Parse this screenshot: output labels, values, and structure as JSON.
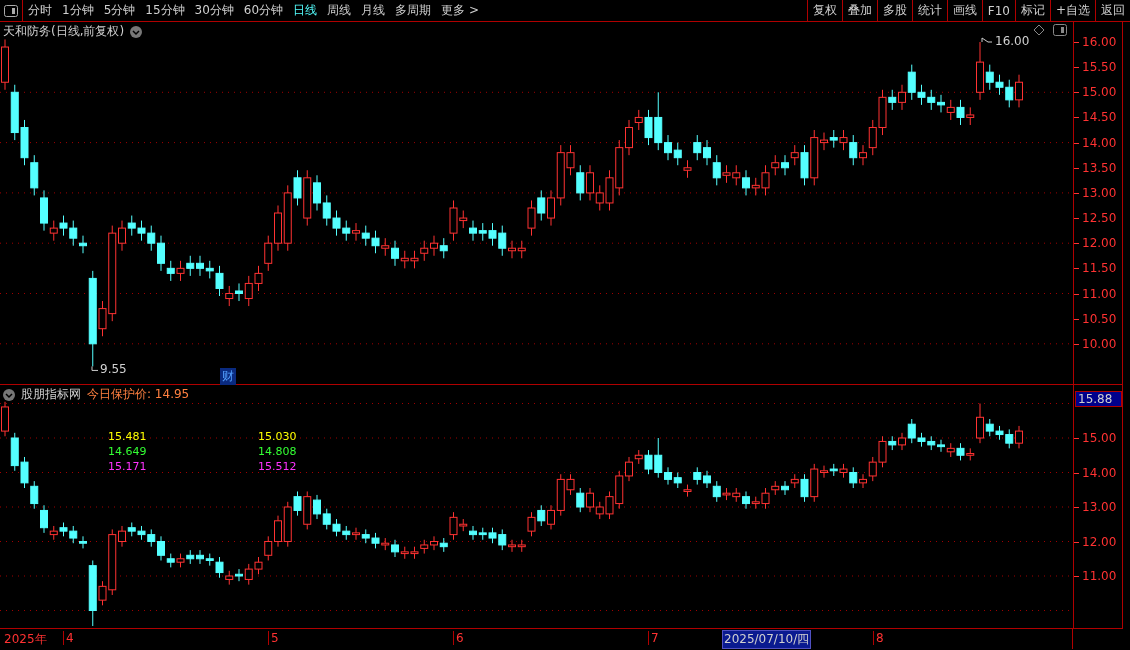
{
  "toolbar": {
    "periods": [
      {
        "label": "分时",
        "selected": false
      },
      {
        "label": "1分钟",
        "selected": false
      },
      {
        "label": "5分钟",
        "selected": false
      },
      {
        "label": "15分钟",
        "selected": false
      },
      {
        "label": "30分钟",
        "selected": false
      },
      {
        "label": "60分钟",
        "selected": false
      },
      {
        "label": "日线",
        "selected": true
      },
      {
        "label": "周线",
        "selected": false
      },
      {
        "label": "月线",
        "selected": false
      },
      {
        "label": "多周期",
        "selected": false
      },
      {
        "label": "更多 >",
        "selected": false
      }
    ],
    "actions": [
      "复权",
      "叠加",
      "多股",
      "统计",
      "画线",
      "F10",
      "标记",
      "+自选",
      "返回"
    ]
  },
  "main_chart": {
    "title": "天和防务(日线,前复权)",
    "high_label": "16.00",
    "low_label": "9.55",
    "badge": "财",
    "y_ticks": [
      "16.00",
      "15.50",
      "15.00",
      "14.50",
      "14.00",
      "13.50",
      "13.00",
      "12.50",
      "12.00",
      "11.50",
      "11.00",
      "10.50",
      "10.00"
    ]
  },
  "indicator": {
    "name": "股朋指标网",
    "protect_price": "今日保护价: 14.95",
    "values": [
      {
        "text": "15.481",
        "color": "#ffff00"
      },
      {
        "text": "15.030",
        "color": "#ffff00"
      },
      {
        "text": "14.649",
        "color": "#33ff33"
      },
      {
        "text": "14.808",
        "color": "#33ff33"
      },
      {
        "text": "15.171",
        "color": "#ff33ff"
      },
      {
        "text": "15.512",
        "color": "#ff33ff"
      }
    ],
    "current_value": "15.88",
    "y_ticks": [
      "15.00",
      "14.00",
      "13.00",
      "12.00",
      "11.00"
    ]
  },
  "time_axis": {
    "year": "2025年",
    "months": [
      "4",
      "5",
      "6",
      "7",
      "8"
    ],
    "cursor_date": "2025/07/10/四"
  }
}
